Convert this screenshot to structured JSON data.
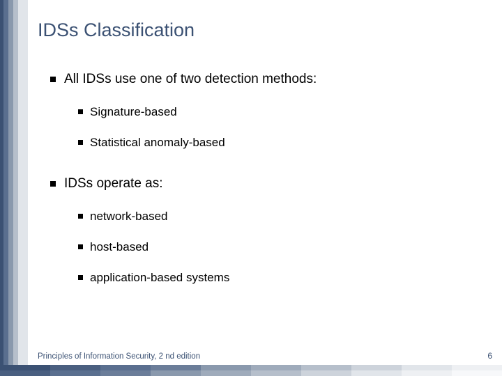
{
  "title": "IDSs Classification",
  "bullets": {
    "b1": "All IDSs use one of two detection methods:",
    "b1a": "Signature-based",
    "b1b": "Statistical anomaly-based",
    "b2": "IDSs operate as:",
    "b2a": " network-based",
    "b2b": "host-based",
    "b2c": " application-based systems"
  },
  "footer": "Principles of Information Security, 2 nd edition",
  "page_number": "6",
  "colors": {
    "accent": "#3b5173",
    "stripes": [
      "#3b5173",
      "#5a6f8f",
      "#8a99ad",
      "#b6bfcb",
      "#e1e5ea"
    ]
  }
}
